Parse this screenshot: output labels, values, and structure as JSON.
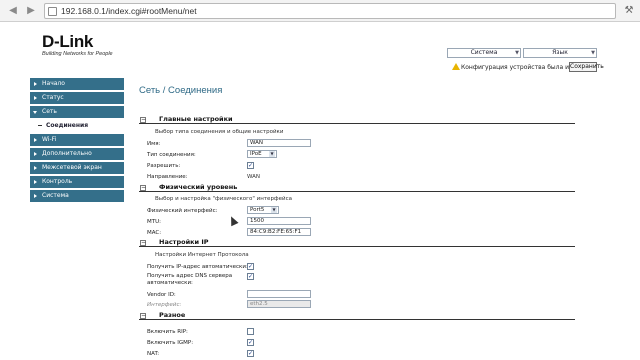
{
  "browser": {
    "url": "192.168.0.1/index.cgi#rootMenu/net"
  },
  "header": {
    "logo": "D-Link",
    "logo_tagline": "Building Networks for People",
    "system_menu": "Система",
    "language_menu": "Язык",
    "warning_text": "Конфигурация устройства была изменена",
    "save_label": "Сохранить"
  },
  "sidebar": {
    "items": [
      {
        "label": "Начало"
      },
      {
        "label": "Статус"
      },
      {
        "label": "Сеть"
      },
      {
        "label": "Wi-Fi"
      },
      {
        "label": "Дополнительно"
      },
      {
        "label": "Межсетевой экран"
      },
      {
        "label": "Контроль"
      },
      {
        "label": "Система"
      }
    ],
    "subitem": "Соединения"
  },
  "main": {
    "title": "Сеть / Соединения",
    "main_section": {
      "title": "Главные настройки",
      "desc": "Выбор типа соединения и общие настройки",
      "name_label": "Имя:",
      "name_value": "WAN",
      "type_label": "Тип соединения:",
      "type_value": "IPoE",
      "enable_label": "Разрешить:",
      "enable_checked": true,
      "direction_label": "Направление:",
      "direction_value": "WAN"
    },
    "phys_section": {
      "title": "Физический уровень",
      "desc": "Выбор и настройка \"физического\" интерфейса",
      "iface_label": "Физический интерфейс:",
      "iface_value": "Port5",
      "mtu_label": "MTU:",
      "mtu_value": "1500",
      "mac_label": "MAC:",
      "mac_value": "84:C9:B2:FE:65:F1"
    },
    "ip_section": {
      "title": "Настройки IP",
      "desc": "Настройки Интернет Протокола",
      "auto_ip_label": "Получить IP-адрес автоматически:",
      "auto_ip_checked": true,
      "auto_dns_label": "Получить адрес DNS сервера автоматически:",
      "auto_dns_checked": true,
      "vendor_label": "Vendor ID:",
      "vendor_value": "",
      "iface_label": "Интерфейс:",
      "iface_value": "eth2.5"
    },
    "misc_section": {
      "title": "Разное",
      "rip_label": "Включить RIP:",
      "rip_checked": false,
      "igmp_label": "Включить IGMP:",
      "igmp_checked": true,
      "nat_label": "NAT:",
      "nat_checked": true
    }
  }
}
